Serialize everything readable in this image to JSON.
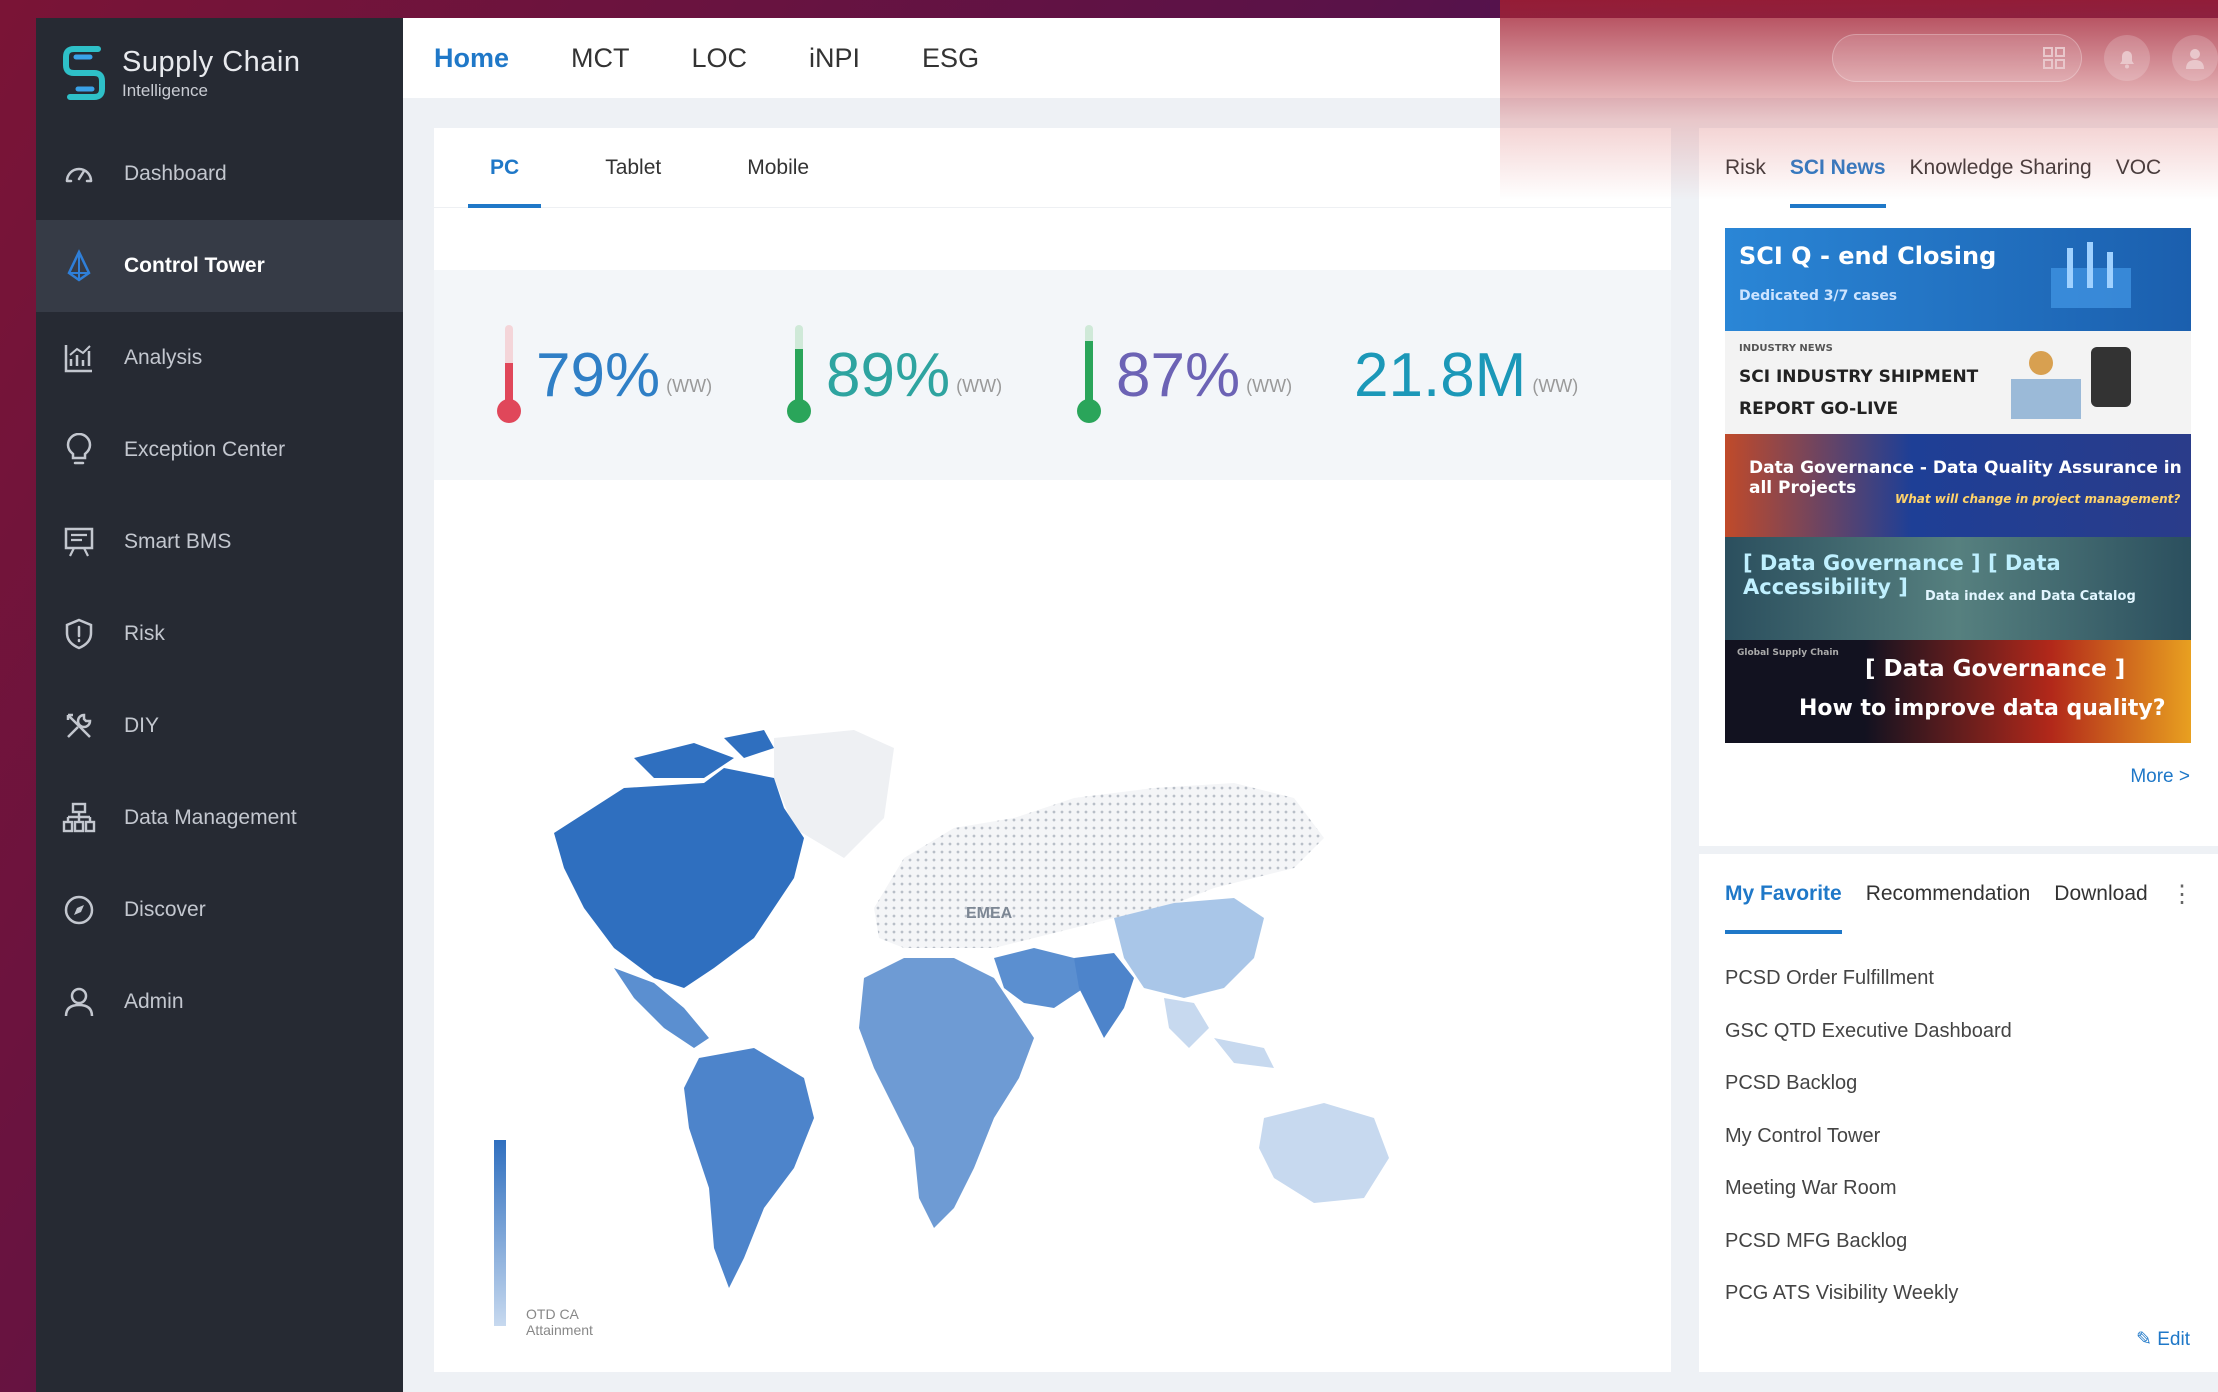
{
  "brand": {
    "title": "Supply Chain",
    "subtitle": "Intelligence"
  },
  "sidebar": {
    "items": [
      {
        "label": "Dashboard",
        "icon": "dashboard-gauge-icon",
        "active": false
      },
      {
        "label": "Control Tower",
        "icon": "control-tower-icon",
        "active": true
      },
      {
        "label": "Analysis",
        "icon": "analysis-chart-icon",
        "active": false
      },
      {
        "label": "Exception Center",
        "icon": "lightbulb-icon",
        "active": false
      },
      {
        "label": "Smart BMS",
        "icon": "presentation-icon",
        "active": false
      },
      {
        "label": "Risk",
        "icon": "shield-alert-icon",
        "active": false
      },
      {
        "label": "DIY",
        "icon": "tools-icon",
        "active": false
      },
      {
        "label": "Data Management",
        "icon": "hierarchy-icon",
        "active": false
      },
      {
        "label": "Discover",
        "icon": "compass-icon",
        "active": false
      },
      {
        "label": "Admin",
        "icon": "user-icon",
        "active": false
      }
    ]
  },
  "topnav": {
    "tabs": [
      "Home",
      "MCT",
      "LOC",
      "iNPI",
      "ESG"
    ],
    "active": "Home"
  },
  "main": {
    "subtabs": [
      "PC",
      "Tablet",
      "Mobile"
    ],
    "active_subtab": "PC",
    "kpis": [
      {
        "value": "79%",
        "unit": "(WW)",
        "thermo_color": "#e0475a",
        "thermo_level": 0.45
      },
      {
        "value": "89%",
        "unit": "(WW)",
        "thermo_color": "#2aa55a",
        "thermo_level": 0.7
      },
      {
        "value": "87%",
        "unit": "(WW)",
        "thermo_color": "#2aa55a",
        "thermo_level": 0.8
      },
      {
        "value": "21.8M",
        "unit": "(WW)"
      }
    ],
    "map": {
      "region_label": "EMEA",
      "legend_label_line1": "OTD CA",
      "legend_label_line2": "Attainment"
    }
  },
  "news": {
    "tabs": [
      "Risk",
      "SCI News",
      "Knowledge Sharing",
      "VOC"
    ],
    "active": "SCI News",
    "banners": [
      {
        "title": "SCI Q - end Closing",
        "subtitle": "Dedicated 3/7 cases",
        "bg": "#2177c9"
      },
      {
        "kicker": "INDUSTRY NEWS",
        "title": "SCI INDUSTRY SHIPMENT",
        "title2": "REPORT GO-LIVE",
        "bg": "#f1f1f1"
      },
      {
        "title": "Data Governance - Data Quality Assurance in all Projects",
        "subtitle": "What will change in project management?",
        "bg": "#27408a"
      },
      {
        "title": "[ Data Governance ] [ Data Accessibility ]",
        "subtitle": "Data index and Data Catalog",
        "bg": "#3d6b7a"
      },
      {
        "kicker": "Global Supply Chain",
        "title": "[ Data Governance ]",
        "title2": "How to improve data quality?",
        "bg": "#1d1d2e"
      }
    ],
    "more": "More >"
  },
  "favorites": {
    "tabs": [
      "My Favorite",
      "Recommendation",
      "Download"
    ],
    "active": "My Favorite",
    "items": [
      "PCSD Order Fulfillment",
      "GSC QTD Executive Dashboard",
      "PCSD Backlog",
      "My Control Tower",
      "Meeting War Room",
      "PCSD MFG Backlog",
      "PCG ATS Visibility Weekly"
    ],
    "edit": "Edit"
  },
  "colors": {
    "accent": "#1f78c8",
    "sidebar_bg": "#262a33",
    "map_dark": "#2f6fbf",
    "map_mid": "#5b8fd0",
    "map_light": "#a9c6e8"
  }
}
